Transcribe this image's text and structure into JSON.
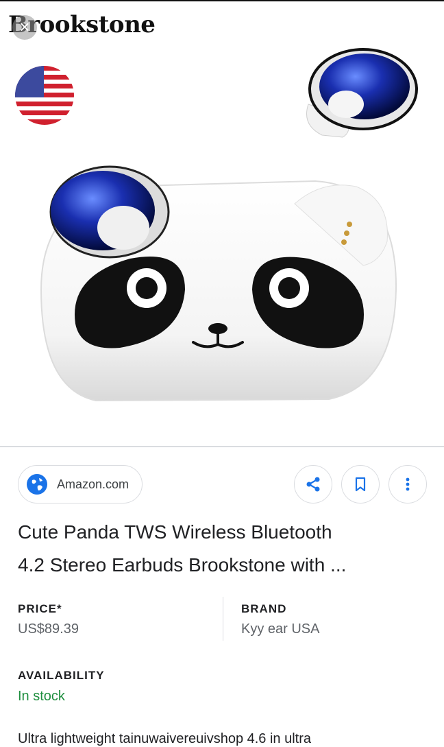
{
  "image": {
    "brand_logo": "Brookstone",
    "close_icon": "close-icon",
    "flag_icon": "us-flag-icon"
  },
  "actions": {
    "source": "Amazon.com",
    "source_icon": "globe-icon",
    "share_icon": "share-icon",
    "bookmark_icon": "bookmark-icon",
    "more_icon": "more-vert-icon"
  },
  "product": {
    "title_line1": "Cute Panda TWS Wireless Bluetooth",
    "title_line2": "4.2 Stereo Earbuds Brookstone with ..."
  },
  "details": {
    "price_label": "PRICE*",
    "price_value": "US$89.39",
    "brand_label": "BRAND",
    "brand_value": "Kyy ear USA",
    "availability_label": "AVAILABILITY",
    "availability_value": "In stock"
  },
  "description": "Ultra lightweight tainuwaivereuivshop 4.6 in ultra",
  "colors": {
    "accent_blue": "#1a73e8",
    "in_stock_green": "#1e8e3e",
    "border": "#dadce0"
  }
}
